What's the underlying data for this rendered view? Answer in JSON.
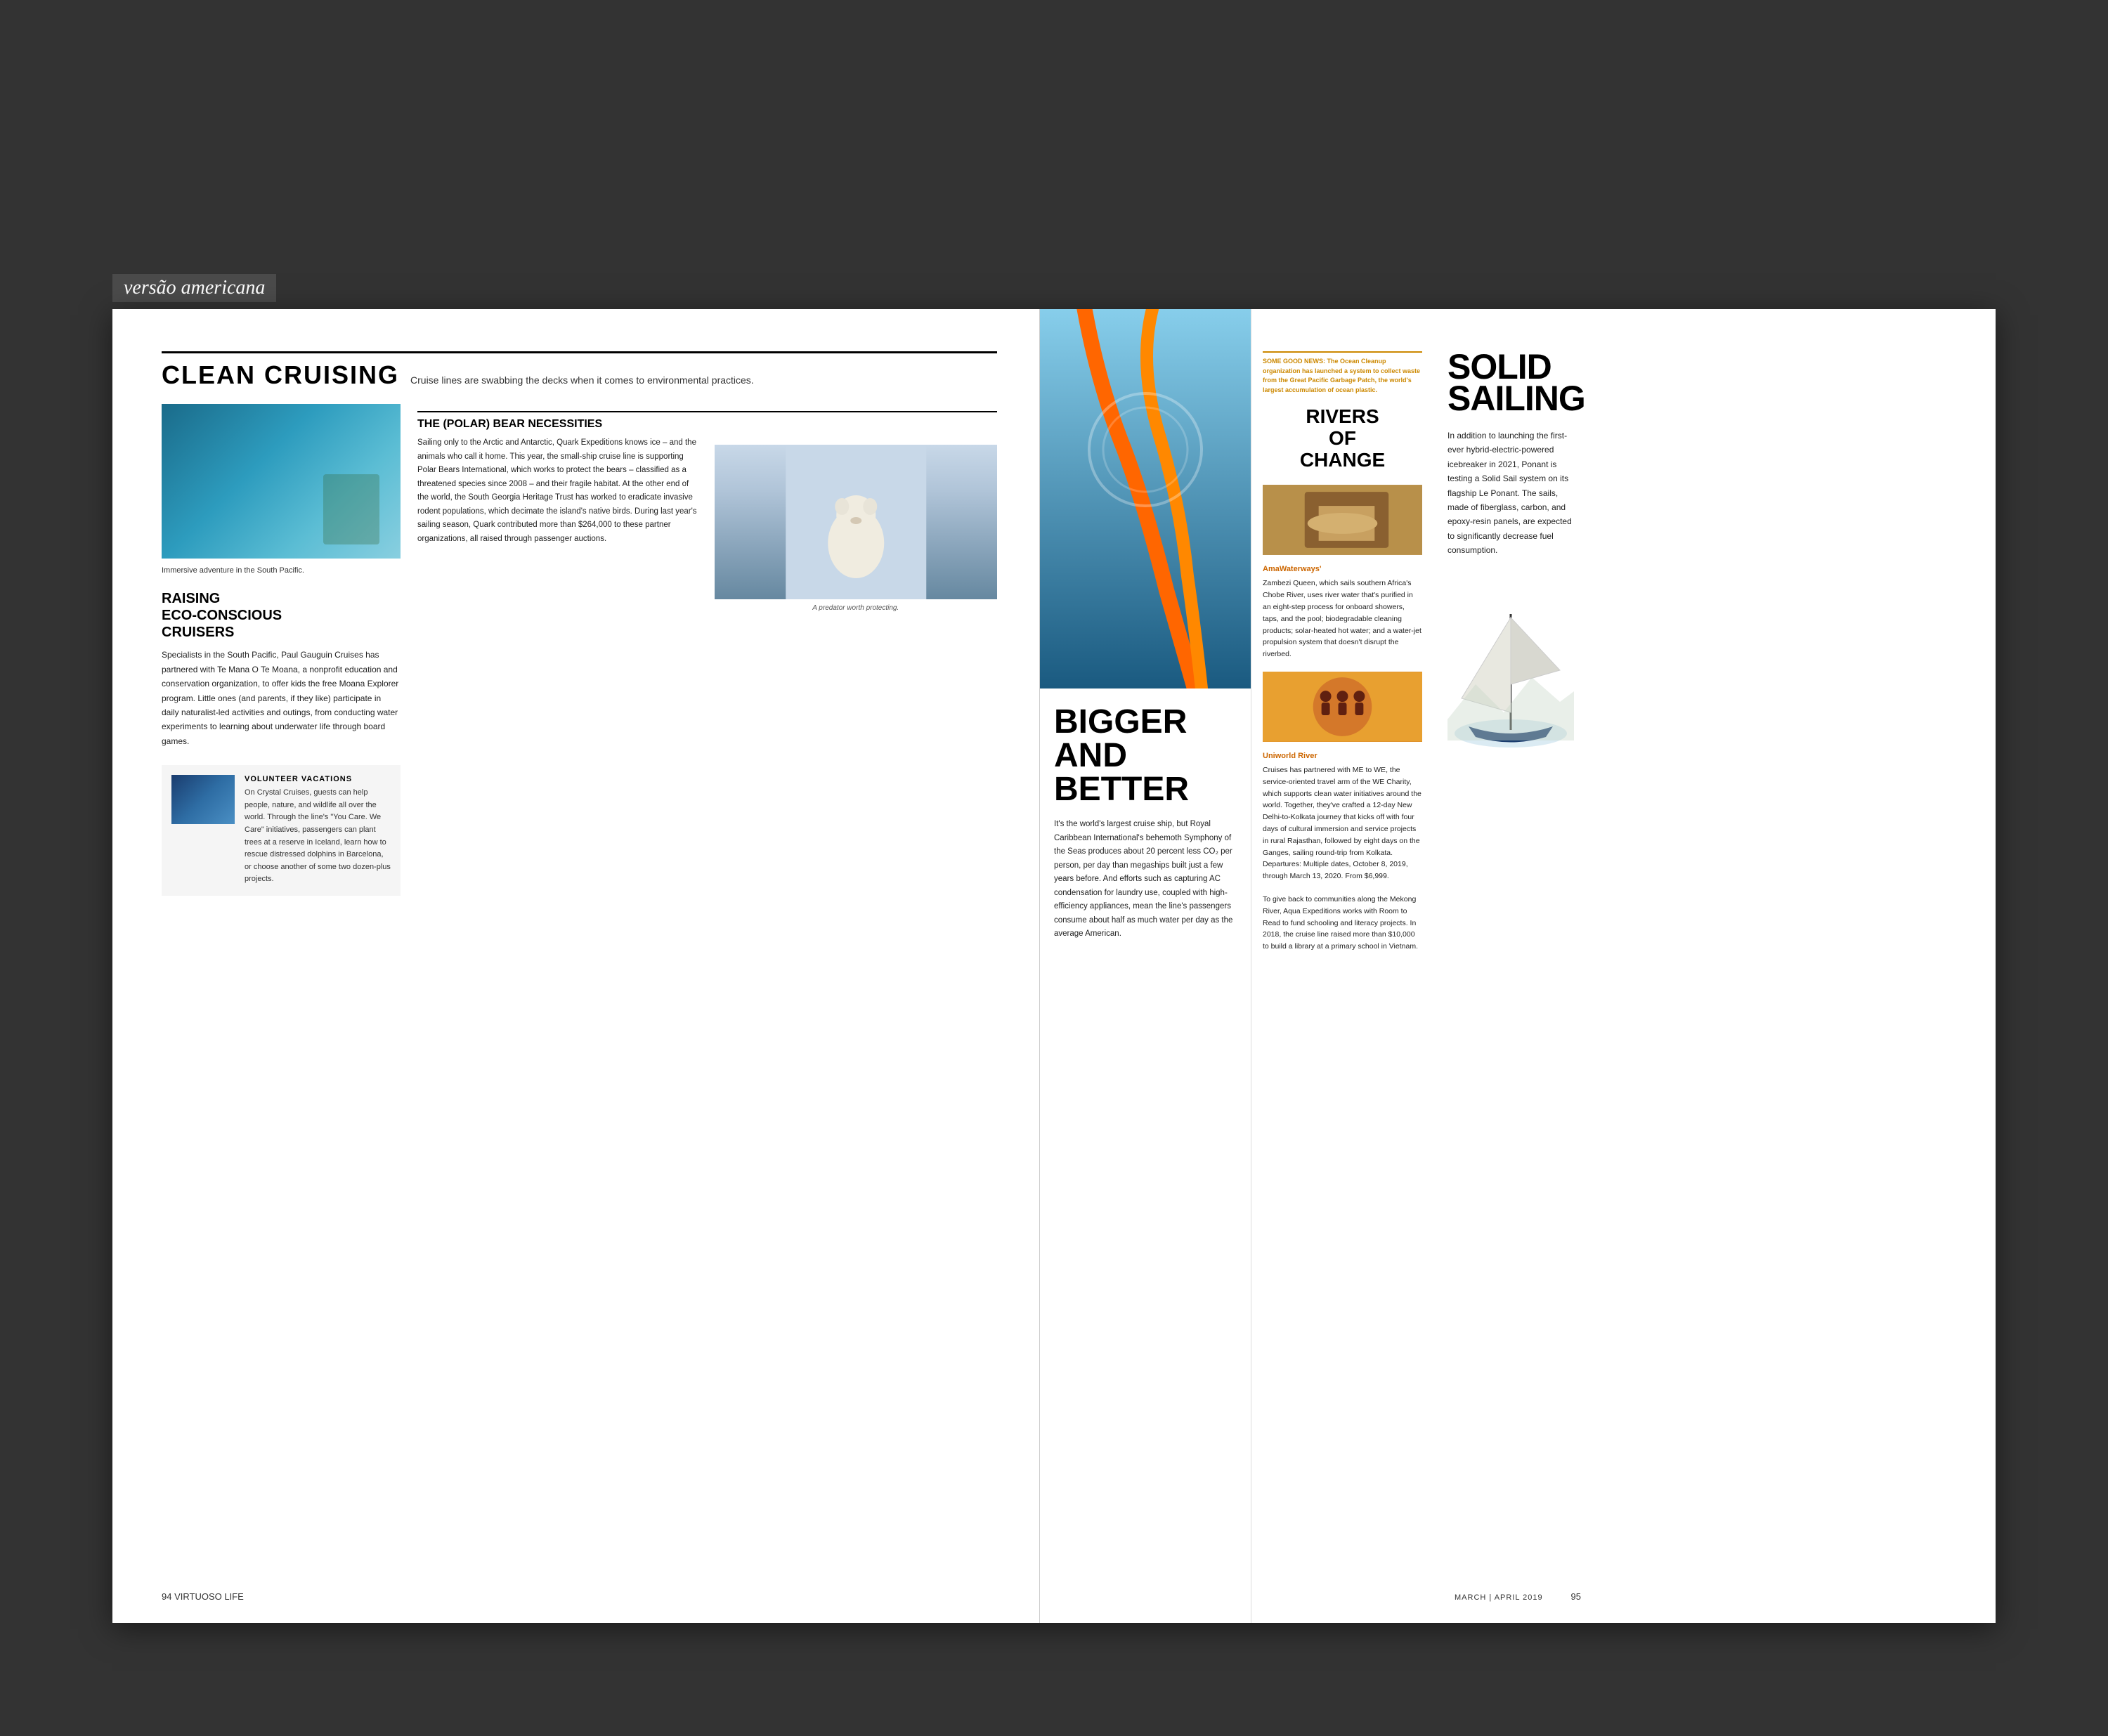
{
  "version_label": "versão americana",
  "spread": {
    "left_page": {
      "page_number": "94  VIRTUOSO LIFE",
      "header": {
        "title": "CLEAN CRUISING",
        "subtitle": "Cruise lines are swabbing the decks when it comes to environmental practices."
      },
      "immersive_caption": "Immersive adventure\nin the South Pacific.",
      "raising": {
        "title": "RAISING\nECO-CONSCIOUS\nCRUISERS",
        "body": "Specialists in the South Pacific, Paul Gauguin Cruises has partnered with Te Mana O Te Moana, a nonprofit education and conservation organization, to offer kids the free Moana Explorer program. Little ones (and parents, if they like) participate in daily naturalist-led activities and outings, from conducting water experiments to learning about underwater life through board games."
      },
      "volunteer": {
        "title": "VOLUNTEER VACATIONS",
        "body": "On Crystal Cruises, guests can help people, nature, and wildlife all over the world. Through the line's \"You Care. We Care\" initiatives, passengers can plant trees at a reserve in Iceland, learn how to rescue distressed dolphins in Barcelona, or choose another of some two dozen-plus projects."
      },
      "polar": {
        "title": "THE (POLAR) BEAR NECESSITIES",
        "body1": "Sailing only to the Arctic and Antarctic, Quark Expeditions knows ice – and the animals who call it home. This year, the small-ship cruise line is supporting Polar Bears International, which works to protect the bears – classified as a threatened species since 2008 – and their fragile habitat. At the other end of the world, the South Georgia Heritage Trust has worked to eradicate invasive rodent populations, which decimate the island's native birds. During last year's sailing season, Quark contributed more than $264,000 to these partner organizations, all raised through passenger auctions.",
        "img_caption": "A predator worth protecting."
      }
    },
    "center": {
      "bigger": {
        "title": "BIGGER\nAND\nBETTER",
        "body": "It's the world's largest cruise ship, but Royal Caribbean International's behemoth Symphony of the Seas produces about 20 percent less CO₂ per person, per day than megaships built just a few years before. And efforts such as capturing AC condensation for laundry use, coupled with high-efficiency appliances, mean the line's passengers consume about half as much water per day as the average American."
      }
    },
    "rivers": {
      "some_good_news": "SOME GOOD NEWS: The Ocean Cleanup organization has launched a system to collect waste from the Great Pacific Garbage Patch, the world's largest accumulation of ocean plastic.",
      "title": "RIVERS\nOF\nCHANGE",
      "amawaterways": {
        "head": "AmaWaterways'",
        "body": "Zambezi Queen, which sails southern Africa's Chobe River, uses river water that's purified in an eight-step process for onboard showers, taps, and the pool; biodegradable cleaning products; solar-heated hot water; and a water-jet propulsion system that doesn't disrupt the riverbed."
      },
      "uniworld": {
        "head": "Uniworld River",
        "body": "Cruises has partnered with ME to WE, the service-oriented travel arm of the WE Charity, which supports clean water initiatives around the world. Together, they've crafted a 12-day New Delhi-to-Kolkata journey that kicks off with four days of cultural immersion and service projects in rural Rajasthan, followed by eight days on the Ganges, sailing round-trip from Kolkata. Departures: Multiple dates, October 8, 2019, through March 13, 2020. From $6,999."
      },
      "aqua": {
        "body": "To give back to communities along the Mekong River, Aqua Expeditions works with Room to Read to fund schooling and literacy projects. In 2018, the cruise line raised more than $10,000 to build a library at a primary school in Vietnam."
      }
    },
    "solid": {
      "title": "SOLID\nSAILING",
      "body": "In addition to launching the first-ever hybrid-electric-powered icebreaker in 2021, Ponant is testing a Solid Sail system on its flagship Le Ponant. The sails, made of fiberglass, carbon, and epoxy-resin panels, are expected to significantly decrease fuel consumption."
    },
    "right_page": {
      "date": "MARCH | APRIL 2019",
      "page_number": "95"
    }
  }
}
